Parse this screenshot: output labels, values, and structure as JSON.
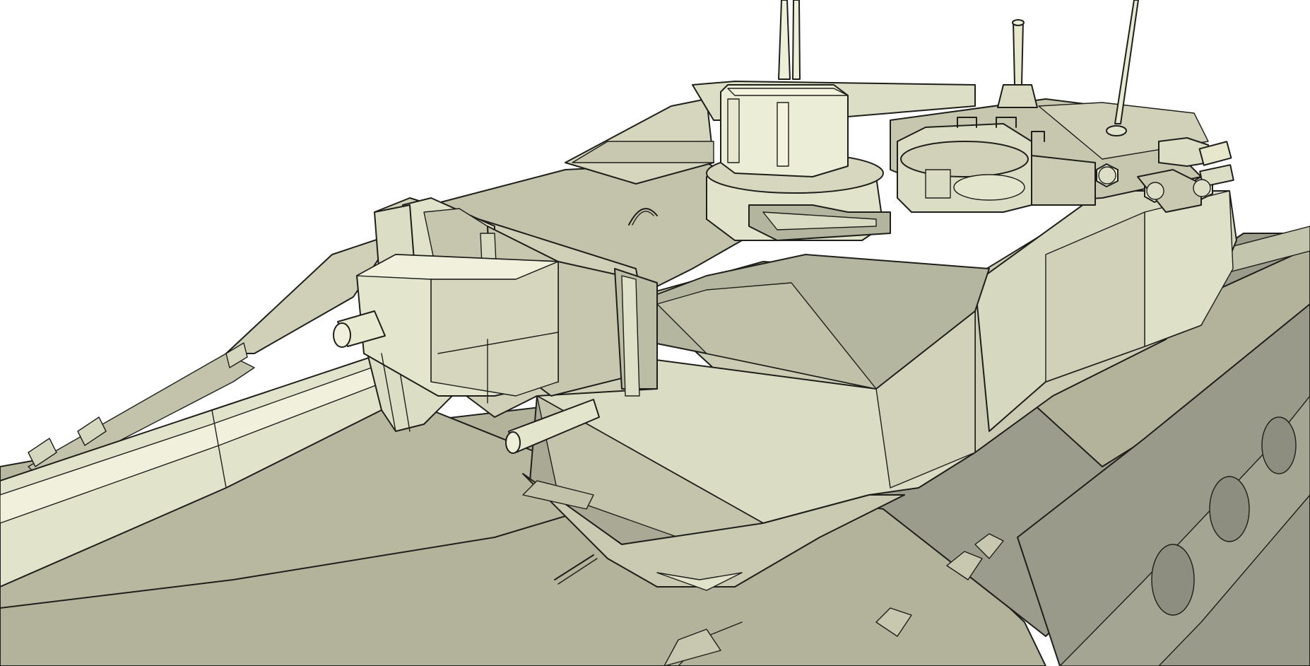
{
  "scene": {
    "subject": "tank",
    "render_style": "sketch",
    "background": "#ffffff",
    "colors": {
      "edge": "#1e1e1a",
      "face_light": "#e6e7cd",
      "face_highlight": "#f3f3de",
      "face_mid": "#cfd0b7",
      "face_shade": "#b3b39c",
      "face_dark": "#98988a",
      "face_deep": "#85857a"
    }
  }
}
